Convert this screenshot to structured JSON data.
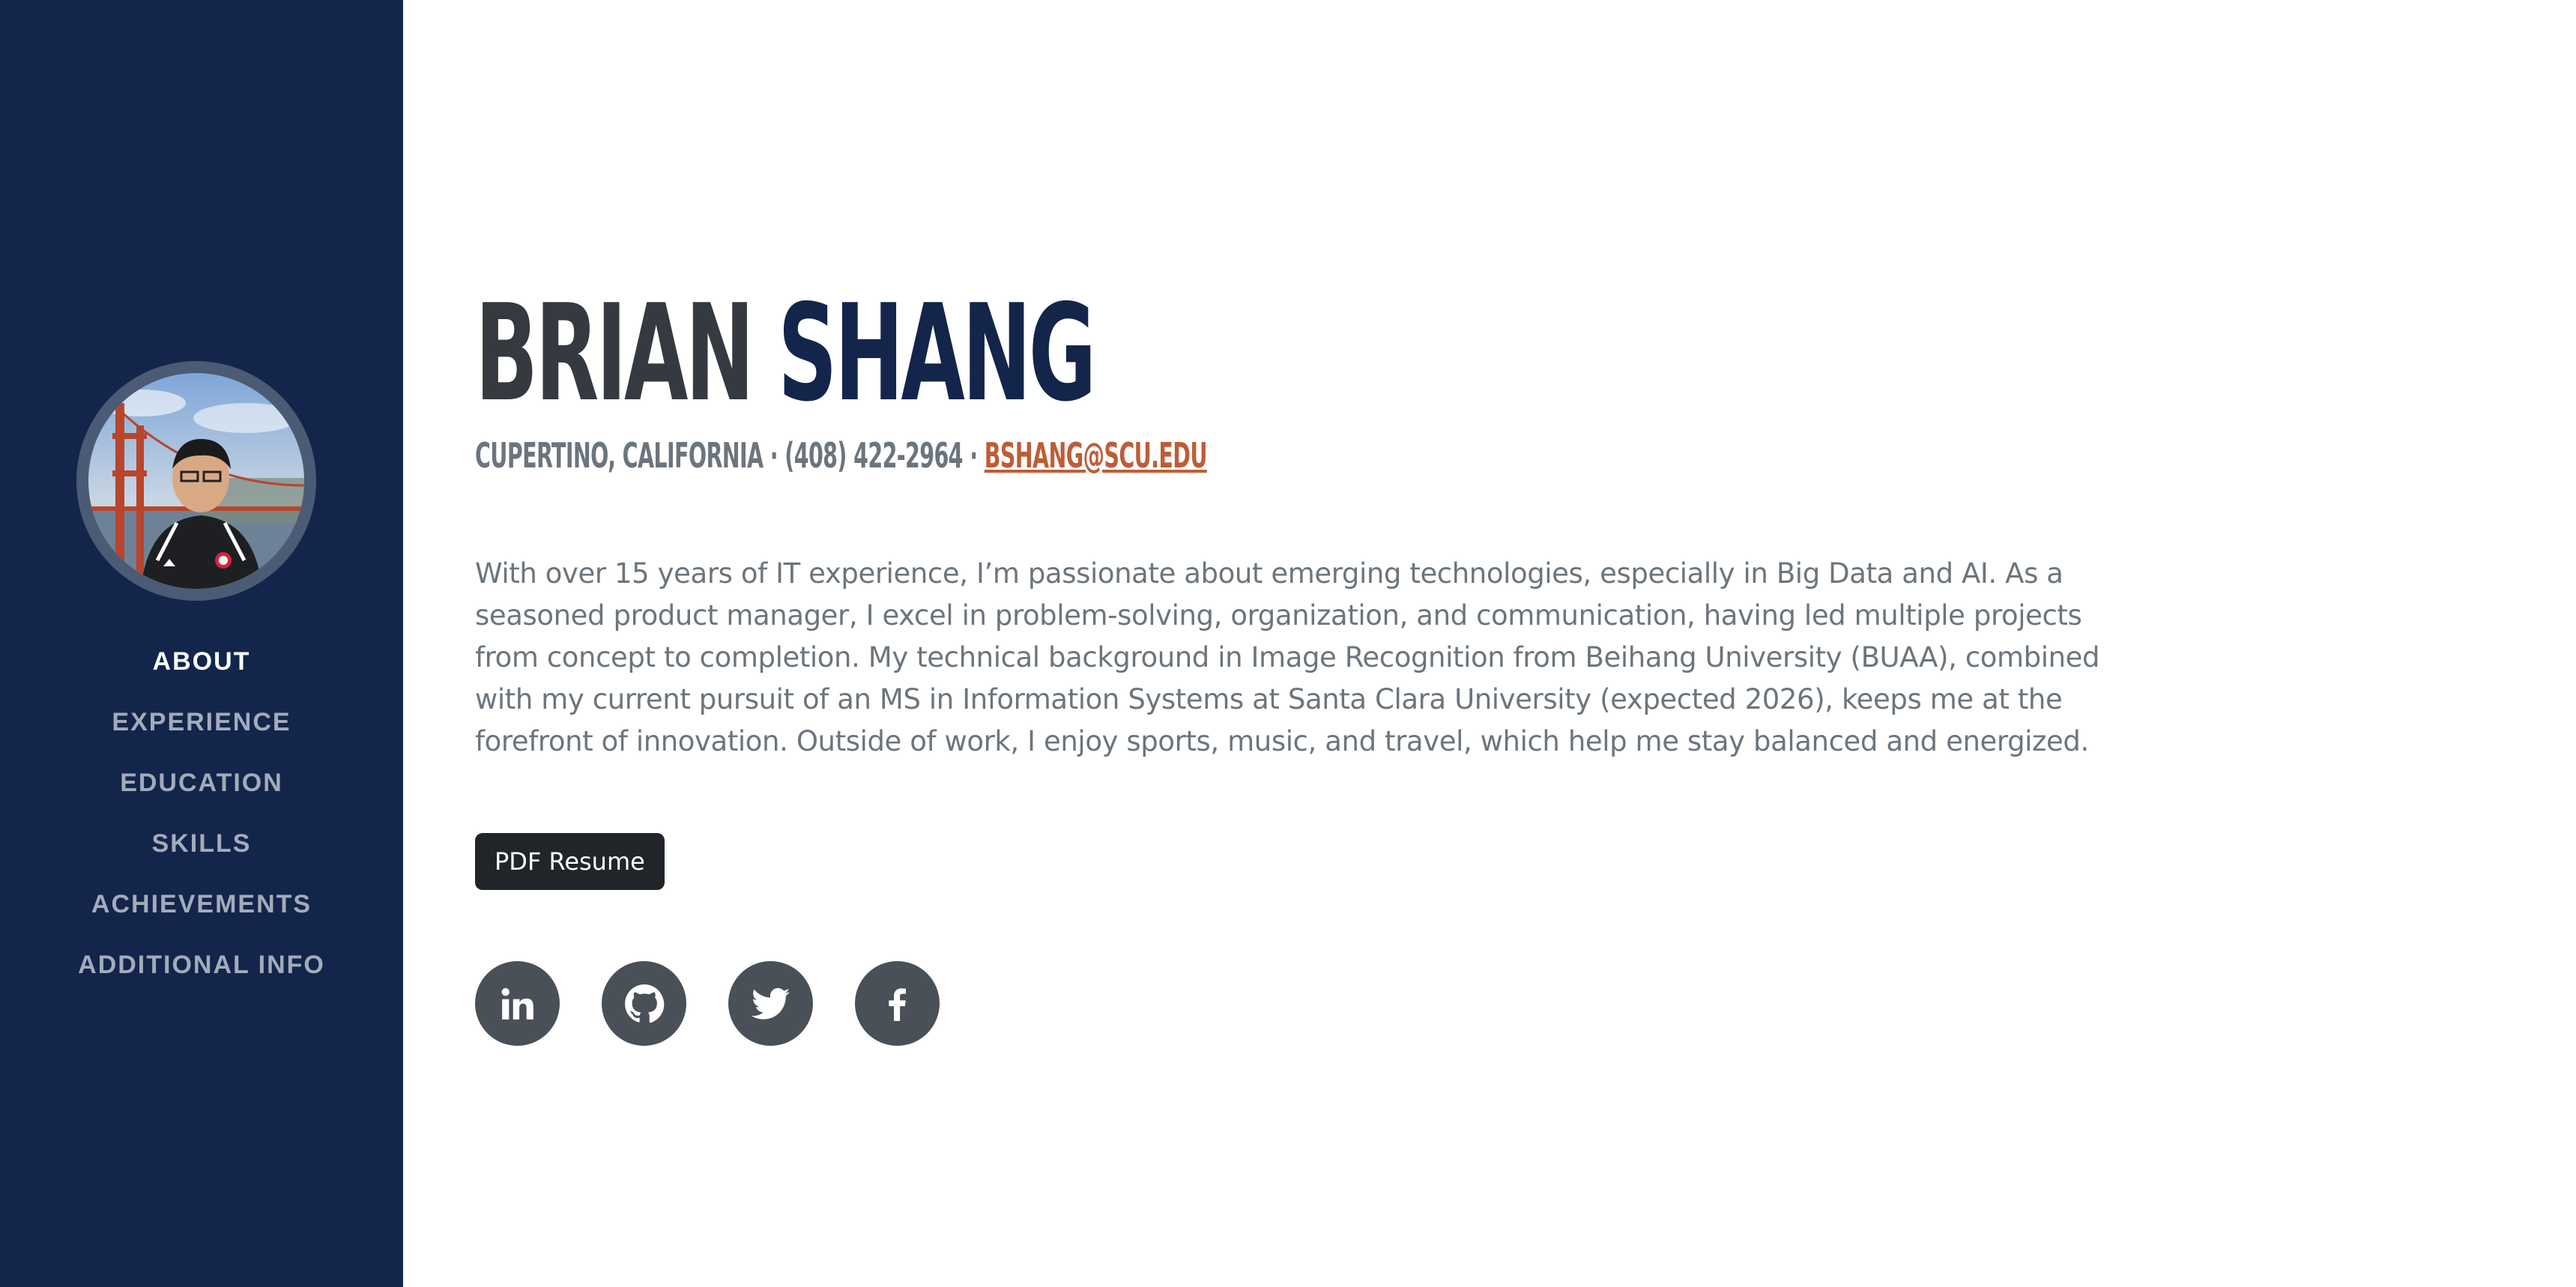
{
  "profile": {
    "first_name": "BRIAN",
    "last_name": "SHANG",
    "location_phone": "CUPERTINO, CALIFORNIA · (408) 422-2964 · ",
    "email": "BSHANG@SCU.EDU",
    "bio": "With over 15 years of IT experience, I’m passionate about emerging technologies, especially in Big Data and AI. As a seasoned product manager, I excel in problem-solving, organization, and communication, having led multiple projects from concept to completion. My technical background in Image Recognition from Beihang University (BUAA), combined with my current pursuit of an MS in Information Systems at Santa Clara University (expected 2026), keeps me at the forefront of innovation. Outside of work, I enjoy sports, music, and travel, which help me stay balanced and energized.",
    "resume_button": "PDF Resume"
  },
  "sidebar": {
    "avatar_icon": "profile-photo",
    "nav": [
      {
        "label": "ABOUT",
        "active": true
      },
      {
        "label": "EXPERIENCE",
        "active": false
      },
      {
        "label": "EDUCATION",
        "active": false
      },
      {
        "label": "SKILLS",
        "active": false
      },
      {
        "label": "ACHIEVEMENTS",
        "active": false
      },
      {
        "label": "ADDITIONAL INFO",
        "active": false
      }
    ]
  },
  "social": [
    {
      "icon": "linkedin-icon"
    },
    {
      "icon": "github-icon"
    },
    {
      "icon": "twitter-icon"
    },
    {
      "icon": "facebook-icon"
    }
  ],
  "colors": {
    "sidebar_bg": "#13254b",
    "accent": "#bd5d38",
    "name_first": "#343a40",
    "name_last": "#13254b",
    "social_bg": "#495057"
  }
}
